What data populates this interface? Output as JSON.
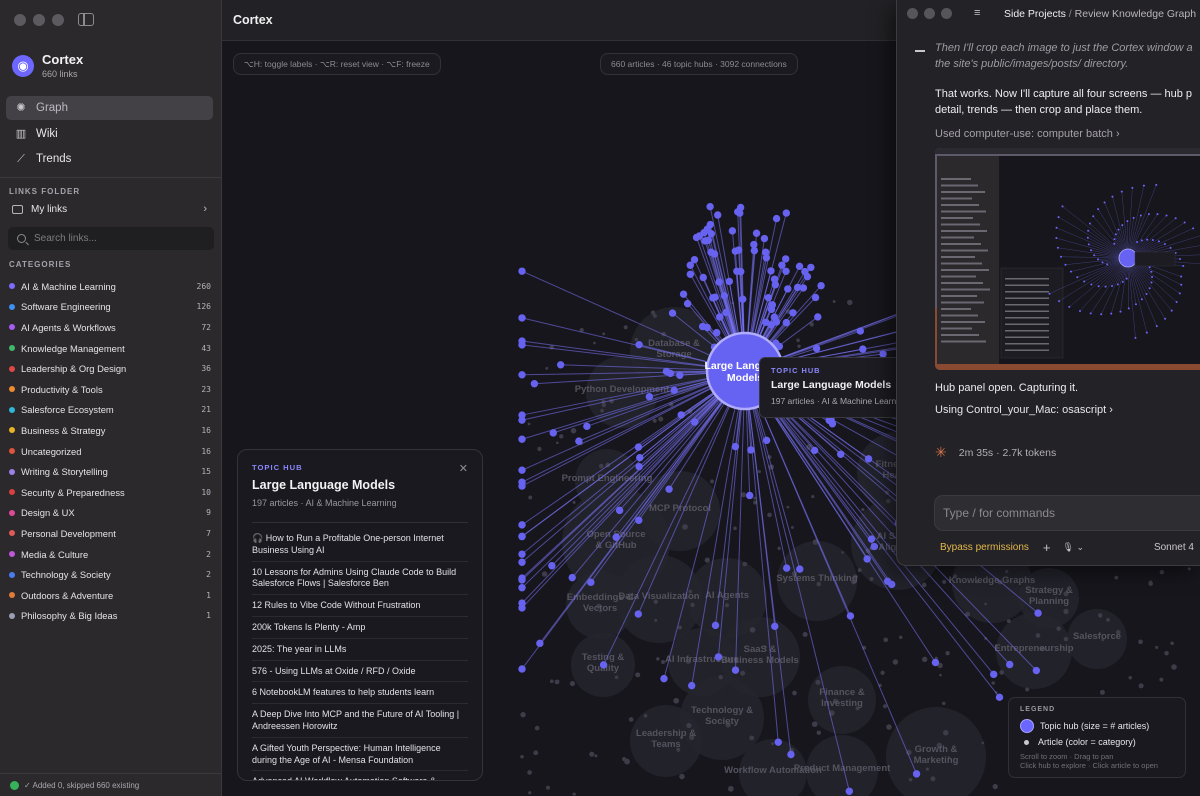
{
  "sidebar": {
    "brand": {
      "title": "Cortex",
      "subtitle": "660 links"
    },
    "nav": [
      {
        "label": "Graph",
        "icon": "graph-icon",
        "active": true
      },
      {
        "label": "Wiki",
        "icon": "book-icon",
        "active": false
      },
      {
        "label": "Trends",
        "icon": "chart-icon",
        "active": false
      }
    ],
    "links_folder_label": "LINKS FOLDER",
    "folder": {
      "label": "My links"
    },
    "search_placeholder": "Search links...",
    "categories_label": "CATEGORIES",
    "categories": [
      {
        "name": "AI & Machine Learning",
        "count": "260",
        "color": "#7b6cff"
      },
      {
        "name": "Software Engineering",
        "count": "126",
        "color": "#3e8ff2"
      },
      {
        "name": "AI Agents & Workflows",
        "count": "72",
        "color": "#a65cf2"
      },
      {
        "name": "Knowledge Management",
        "count": "43",
        "color": "#3fb86a"
      },
      {
        "name": "Leadership & Org Design",
        "count": "36",
        "color": "#e04848"
      },
      {
        "name": "Productivity & Tools",
        "count": "23",
        "color": "#ee8a30"
      },
      {
        "name": "Salesforce Ecosystem",
        "count": "21",
        "color": "#2fb6d9"
      },
      {
        "name": "Business & Strategy",
        "count": "16",
        "color": "#e6b323"
      },
      {
        "name": "Uncategorized",
        "count": "16",
        "color": "#e0533c"
      },
      {
        "name": "Writing & Storytelling",
        "count": "15",
        "color": "#9a82e8"
      },
      {
        "name": "Security & Preparedness",
        "count": "10",
        "color": "#d94040"
      },
      {
        "name": "Design & UX",
        "count": "9",
        "color": "#e0499a"
      },
      {
        "name": "Personal Development",
        "count": "7",
        "color": "#e05a5a"
      },
      {
        "name": "Media & Culture",
        "count": "2",
        "color": "#c056d8"
      },
      {
        "name": "Technology & Society",
        "count": "2",
        "color": "#4a7bf0"
      },
      {
        "name": "Outdoors & Adventure",
        "count": "1",
        "color": "#e07b3a"
      },
      {
        "name": "Philosophy & Big Ideas",
        "count": "1",
        "color": "#9aa0b4"
      }
    ],
    "status": "✓ Added 0, skipped 660 existing"
  },
  "main": {
    "title": "Cortex",
    "shortcuts": "⌥H: toggle labels · ⌥R: reset view · ⌥F: freeze",
    "stats": "660 articles · 46 topic hubs · 3092 connections",
    "hub_node_label": "Large Language Models",
    "topic_labels": [
      "Database & Storage",
      "Python Development",
      "Prompt Engineering",
      "Open Source & GitHub",
      "MCP Protocol",
      "Embeddings & Vectors",
      "Data Visualization",
      "AI Agents",
      "SaaS & Business Models",
      "Testing & Quality",
      "AI Infrastructure",
      "Systems Thinking",
      "AI Safety & Alignment",
      "Fitness & Health",
      "Outdoor & Adventure",
      "Knowledge Graphs",
      "Strategy & Planning",
      "Finance & Investing",
      "Technology & Society",
      "Leadership & Teams",
      "Workflow Automation",
      "Product Management",
      "Growth & Marketing",
      "Entrepreneurship",
      "Salesforce"
    ],
    "tooltip": {
      "kicker": "TOPIC HUB",
      "title": "Large Language Models",
      "subtitle": "197 articles · AI & Machine Learning"
    },
    "hub_panel": {
      "kicker": "TOPIC HUB",
      "title": "Large Language Models",
      "subtitle": "197 articles · AI & Machine Learning",
      "articles": [
        "🎧 How to Run a Profitable One-person Internet Business Using AI",
        "10 Lessons for Admins Using Claude Code to Build Salesforce Flows | Salesforce Ben",
        "12 Rules to Vibe Code Without Frustration",
        "200k Tokens Is Plenty - Amp",
        "2025: The year in LLMs",
        "576 - Using LLMs at Oxide / RFD / Oxide",
        "6 NotebookLM features to help students learn",
        "A Deep Dive Into MCP and the Future of AI Tooling | Andreessen Horowitz",
        "A Gifted Youth Perspective: Human Intelligence during the Age of AI - Mensa Foundation",
        "Advanced AI Workflow Automation Software &"
      ]
    },
    "legend": {
      "title": "LEGEND",
      "hub": "Topic hub (size = # articles)",
      "article": "Article (color = category)",
      "hint1": "Scroll to zoom · Drag to pan",
      "hint2": "Click hub to explore · Click article to open"
    }
  },
  "chat": {
    "breadcrumb_project": "Side Projects",
    "breadcrumb_separator": " / ",
    "breadcrumb_title": "Review Knowledge Graph",
    "italic_lines": [
      "Then I'll crop each image to just the Cortex window a",
      "the site's public/images/posts/ directory."
    ],
    "paragraph_lines": [
      "That works. Now I'll capture all four screens — hub p",
      "detail, trends — then crop and place them."
    ],
    "tool_used": "Used computer-use: computer batch ›",
    "after_shot": "Hub panel open. Capturing it.",
    "tool_using": "Using Control_your_Mac: osascript ›",
    "spinner": "2m 35s · 2.7k tokens",
    "input_placeholder": "Type / for commands",
    "bypass": "Bypass permissions",
    "model": "Sonnet 4"
  }
}
